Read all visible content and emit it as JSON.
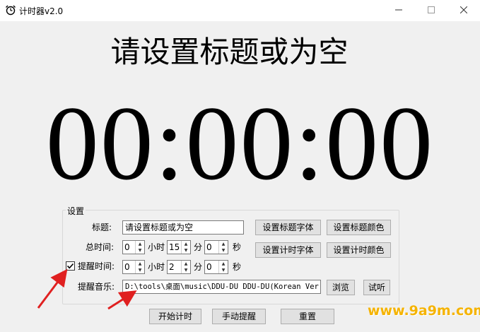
{
  "window": {
    "title": "计时器v2.0",
    "controls": {
      "minimize": "—",
      "maximize": "☐",
      "close": "✕"
    }
  },
  "display": {
    "title": "请设置标题或为空",
    "timer": "00:00:00"
  },
  "settings": {
    "group_label": "设置",
    "title_label": "标题:",
    "title_value": "请设置标题或为空",
    "total_time_label": "总时间:",
    "total_time": {
      "hours": "0",
      "hours_unit": "小时",
      "minutes": "15",
      "minutes_unit": "分",
      "seconds": "0",
      "seconds_unit": "秒"
    },
    "reminder_checked": true,
    "reminder_label": "提醒时间:",
    "reminder_time": {
      "hours": "0",
      "hours_unit": "小时",
      "minutes": "2",
      "minutes_unit": "分",
      "seconds": "0",
      "seconds_unit": "秒"
    },
    "music_label": "提醒音乐:",
    "music_path": "D:\\tools\\桌面\\music\\DDU-DU  DDU-DU(Korean  Ver",
    "buttons": {
      "title_font": "设置标题字体",
      "title_color": "设置标题颜色",
      "timer_font": "设置计时字体",
      "timer_color": "设置计时颜色",
      "browse": "浏览",
      "preview": "试听"
    }
  },
  "actions": {
    "start": "开始计时",
    "manual_remind": "手动提醒",
    "reset": "重置"
  },
  "watermark": "www.9a9m.com",
  "colors": {
    "annotation_arrow": "#e02020",
    "watermark": "#f5b300"
  }
}
